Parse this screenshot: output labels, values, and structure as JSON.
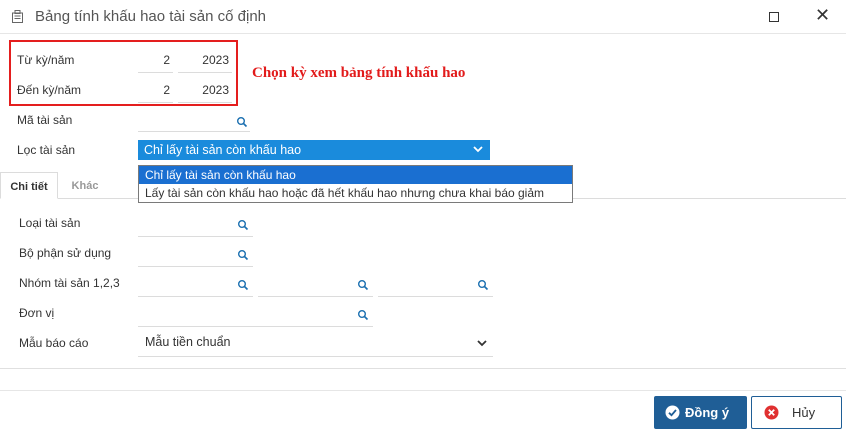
{
  "window": {
    "title": "Bảng tính khấu hao tài sản cố định",
    "close_glyph": "✕"
  },
  "period": {
    "from_label": "Từ kỳ/năm",
    "from_period": "2",
    "from_year": "2023",
    "to_label": "Đến kỳ/năm",
    "to_period": "2",
    "to_year": "2023"
  },
  "annotation": "Chọn kỳ xem bảng tính khấu hao",
  "asset_code": {
    "label": "Mã tài sản",
    "value": ""
  },
  "filter": {
    "label": "Lọc tài sản",
    "selected": "Chỉ lấy tài sản còn khấu hao",
    "options": [
      "Chỉ lấy tài sản còn khấu hao",
      "Lấy tài sản còn khấu hao hoặc đã hết khấu hao nhưng chưa khai báo giảm"
    ]
  },
  "tabs": [
    {
      "label": "Chi tiết",
      "active": true
    },
    {
      "label": "Khác",
      "active": false
    }
  ],
  "details": {
    "asset_type_label": "Loại tài sản",
    "department_label": "Bộ phận sử dụng",
    "group_label": "Nhóm tài sản 1,2,3",
    "unit_label": "Đơn vị",
    "template_label": "Mẫu báo cáo",
    "template_value": "Mẫu tiền chuẩn"
  },
  "buttons": {
    "ok": "Đồng ý",
    "cancel": "Hủy"
  },
  "colors": {
    "accent": "#1a8bdc",
    "primary_button": "#1f5e96",
    "annotation": "#e21b1b",
    "highlight_border": "#e41e1e"
  },
  "icons": [
    "app-icon",
    "maximize-icon",
    "close-icon",
    "search-icon",
    "chevron-down-icon",
    "check-circle-icon",
    "cancel-circle-icon"
  ]
}
